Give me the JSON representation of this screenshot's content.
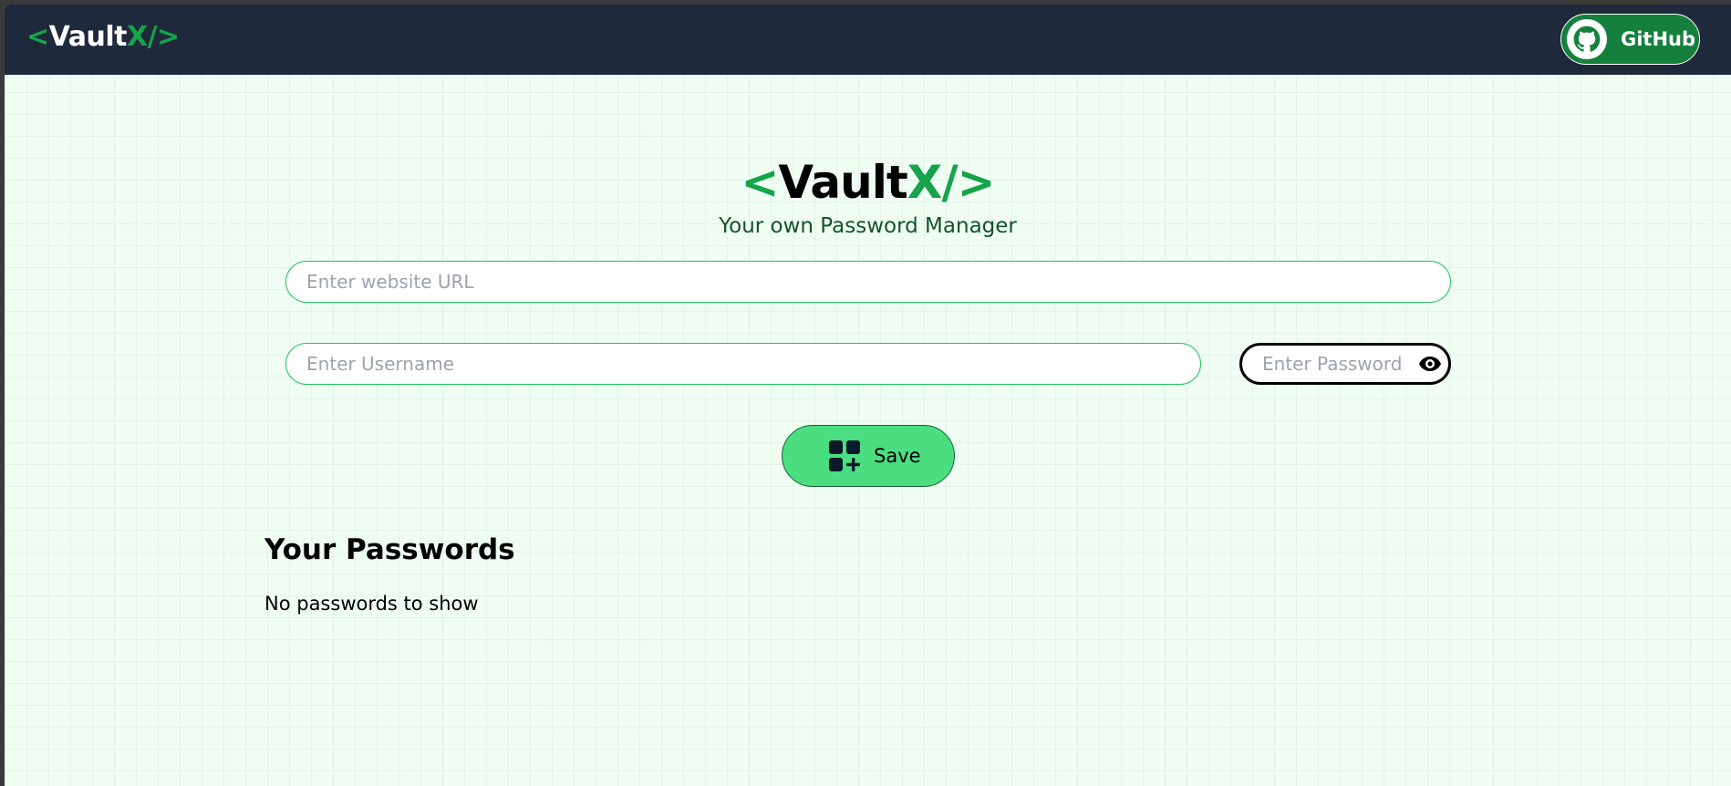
{
  "navbar": {
    "logo": {
      "open_bracket": "<",
      "name": "Vault",
      "accent": "X/",
      "close_bracket": ">"
    },
    "github_button": {
      "label": "GitHub",
      "icon": "github-icon"
    }
  },
  "hero": {
    "logo": {
      "open_bracket": "<",
      "name": "Vault",
      "accent": "X/",
      "close_bracket": ">"
    },
    "tagline": "Your own Password Manager"
  },
  "form": {
    "url_placeholder": "Enter website URL",
    "url_value": "",
    "username_placeholder": "Enter Username",
    "username_value": "",
    "password_placeholder": "Enter Password",
    "password_value": "",
    "show_password_icon": "eye-icon",
    "save_button": {
      "label": "Save",
      "icon": "add-grid-icon"
    }
  },
  "passwords": {
    "title": "Your Passwords",
    "empty_message": "No passwords to show"
  },
  "colors": {
    "navbar_bg": "#1e293b",
    "accent_green": "#16a34a",
    "page_bg": "#effdf3",
    "save_button_bg": "#4ade80",
    "github_button_bg": "#15803d",
    "input_border": "#22c55e"
  }
}
